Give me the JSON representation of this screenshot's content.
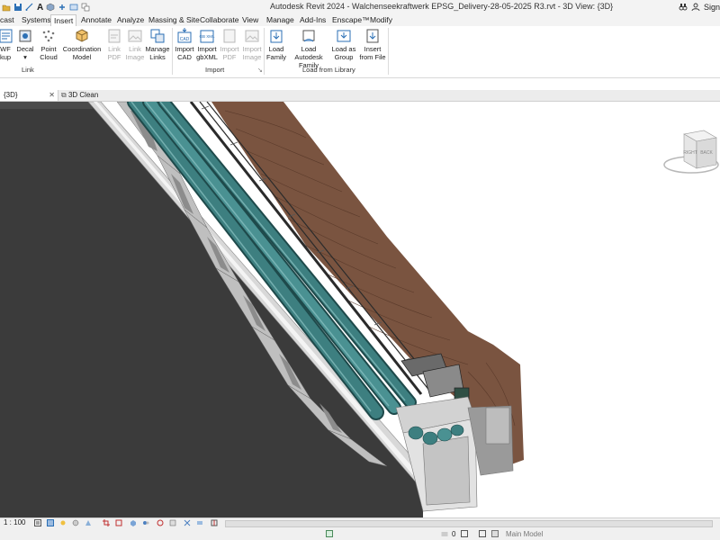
{
  "app": {
    "title": "Autodesk Revit 2024 - Walchenseekraftwerk EPSG_Delivery-28-05-2025 R3.rvt - 3D View: {3D}",
    "sign_in": "Sign"
  },
  "tabs": [
    {
      "label": "cast"
    },
    {
      "label": "Systems"
    },
    {
      "label": "Insert"
    },
    {
      "label": "Annotate"
    },
    {
      "label": "Analyze"
    },
    {
      "label": "Massing & Site"
    },
    {
      "label": "Collaborate"
    },
    {
      "label": "View"
    },
    {
      "label": "Manage"
    },
    {
      "label": "Add-Ins"
    },
    {
      "label": "Enscape™"
    },
    {
      "label": "Modify"
    }
  ],
  "ribbon": {
    "link_buttons": [
      {
        "line1": "WF",
        "line2": "kup",
        "enabled": true
      },
      {
        "line1": "Decal",
        "line2": "▾",
        "enabled": true
      },
      {
        "line1": "Point",
        "line2": "Cloud",
        "enabled": true
      },
      {
        "line1": "Coordination",
        "line2": "Model",
        "enabled": true
      },
      {
        "line1": "Link",
        "line2": "PDF",
        "enabled": false
      },
      {
        "line1": "Link",
        "line2": "Image",
        "enabled": false
      },
      {
        "line1": "Manage",
        "line2": "Links",
        "enabled": true
      }
    ],
    "import_buttons": [
      {
        "line1": "Import",
        "line2": "CAD",
        "enabled": true
      },
      {
        "line1": "Import",
        "line2": "gbXML",
        "enabled": true
      },
      {
        "line1": "Import",
        "line2": "PDF",
        "enabled": false
      },
      {
        "line1": "Import",
        "line2": "Image",
        "enabled": false
      }
    ],
    "library_buttons": [
      {
        "line1": "Load",
        "line2": "Family",
        "enabled": true
      },
      {
        "line1": "Load Autodesk",
        "line2": "Family",
        "enabled": true
      },
      {
        "line1": "Load as",
        "line2": "Group",
        "enabled": true
      },
      {
        "line1": "Insert",
        "line2": "from File",
        "enabled": true
      }
    ],
    "panels": {
      "link": "Link",
      "import": "Import",
      "library": "Load from Library"
    },
    "icon_labels": {
      "cad": "CAD",
      "gbxml": "GB XML"
    }
  },
  "view_tabs": [
    {
      "label": "{3D}",
      "active": true
    },
    {
      "label": "3D Clean",
      "active": false
    }
  ],
  "viewcube": {
    "right": "RIGHT",
    "back": "BACK"
  },
  "status": {
    "scale": "1 : 100",
    "workset": "0",
    "model": "Main Model"
  },
  "colors": {
    "terrain": "#7a5440",
    "pipe": "#3d7f80",
    "concrete": "#c9c9c9",
    "dark_fill": "#3b3b3b",
    "accent": "#2b6fb5"
  }
}
